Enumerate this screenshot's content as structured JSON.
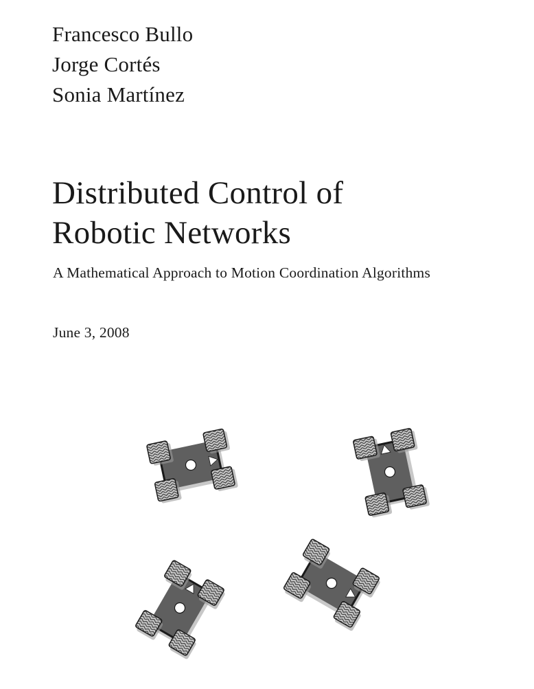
{
  "authors": [
    "Francesco Bullo",
    "Jorge Cortés",
    "Sonia Martínez"
  ],
  "title": {
    "line1": "Distributed Control of",
    "line2": "Robotic Networks"
  },
  "subtitle": "A Mathematical Approach to Motion Coordination Algorithms",
  "date": "June 3, 2008",
  "illustration": {
    "robot_count": 4,
    "robots": [
      {
        "name": "robot-1",
        "heading": "right"
      },
      {
        "name": "robot-2",
        "heading": "up"
      },
      {
        "name": "robot-3",
        "heading": "up"
      },
      {
        "name": "robot-4",
        "heading": "right"
      }
    ],
    "colors": {
      "body": "#5f5f5f",
      "wheel": "#c4c4c4",
      "shadow": "#9a9a9a",
      "outline": "#1a1a1a",
      "marker": "#ffffff"
    }
  }
}
